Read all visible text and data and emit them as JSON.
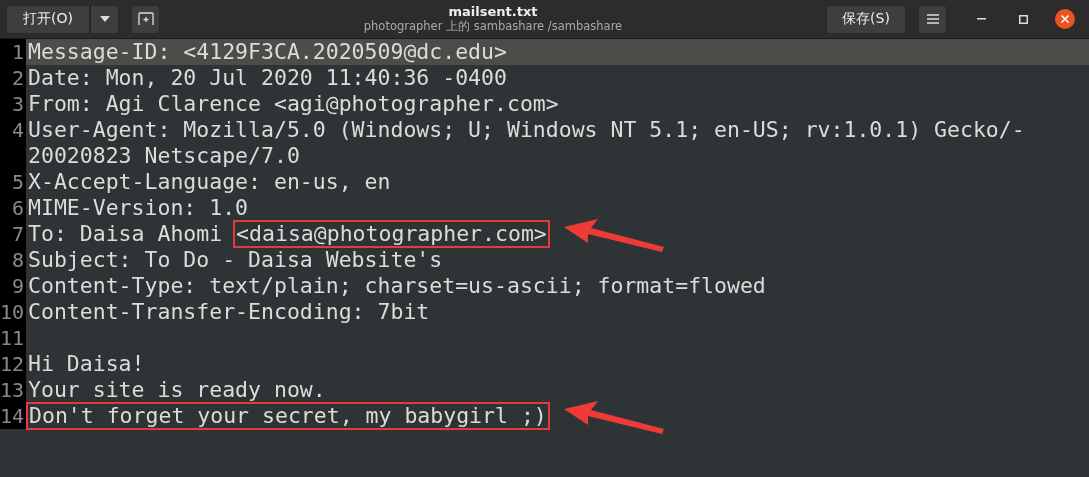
{
  "header": {
    "open_button": "打开(O)",
    "title": "mailsent.txt",
    "subtitle": "photographer 上的 sambashare /sambashare",
    "save_button": "保存(S)"
  },
  "lines": [
    {
      "number": "1",
      "current": true,
      "rows": [
        [
          {
            "text": "Message-ID: <4129F3CA.2020509@dc.edu>",
            "boxed": false
          }
        ]
      ],
      "arrow": false
    },
    {
      "number": "2",
      "current": false,
      "rows": [
        [
          {
            "text": "Date: Mon, 20 Jul 2020 11:40:36 -0400",
            "boxed": false
          }
        ]
      ],
      "arrow": false
    },
    {
      "number": "3",
      "current": false,
      "rows": [
        [
          {
            "text": "From: Agi Clarence <agi@photographer.com>",
            "boxed": false
          }
        ]
      ],
      "arrow": false
    },
    {
      "number": "4",
      "current": false,
      "rows": [
        [
          {
            "text": "User-Agent: Mozilla/5.0 (Windows; U; Windows NT 5.1; en-US; rv:1.0.1) Gecko/-",
            "boxed": false
          }
        ],
        [
          {
            "text": "20020823 Netscape/7.0",
            "boxed": false
          }
        ]
      ],
      "arrow": false
    },
    {
      "number": "5",
      "current": false,
      "rows": [
        [
          {
            "text": "X-Accept-Language: en-us, en",
            "boxed": false
          }
        ]
      ],
      "arrow": false
    },
    {
      "number": "6",
      "current": false,
      "rows": [
        [
          {
            "text": "MIME-Version: 1.0",
            "boxed": false
          }
        ]
      ],
      "arrow": false
    },
    {
      "number": "7",
      "current": false,
      "rows": [
        [
          {
            "text": "To: Daisa Ahomi ",
            "boxed": false
          },
          {
            "text": "<daisa@photographer.com>",
            "boxed": true
          }
        ]
      ],
      "arrow": true
    },
    {
      "number": "8",
      "current": false,
      "rows": [
        [
          {
            "text": "Subject: To Do - Daisa Website's",
            "boxed": false
          }
        ]
      ],
      "arrow": false
    },
    {
      "number": "9",
      "current": false,
      "rows": [
        [
          {
            "text": "Content-Type: text/plain; charset=us-ascii; format=flowed",
            "boxed": false
          }
        ]
      ],
      "arrow": false
    },
    {
      "number": "10",
      "current": false,
      "rows": [
        [
          {
            "text": "Content-Transfer-Encoding: 7bit",
            "boxed": false
          }
        ]
      ],
      "arrow": false
    },
    {
      "number": "11",
      "current": false,
      "rows": [
        []
      ],
      "arrow": false
    },
    {
      "number": "12",
      "current": false,
      "rows": [
        [
          {
            "text": "Hi Daisa!",
            "boxed": false
          }
        ]
      ],
      "arrow": false
    },
    {
      "number": "13",
      "current": false,
      "rows": [
        [
          {
            "text": "Your site is ready now.",
            "boxed": false
          }
        ]
      ],
      "arrow": false
    },
    {
      "number": "14",
      "current": false,
      "rows": [
        [
          {
            "text": "Don't forget your secret, my babygirl ;)",
            "boxed": true
          }
        ]
      ],
      "arrow": true
    }
  ]
}
